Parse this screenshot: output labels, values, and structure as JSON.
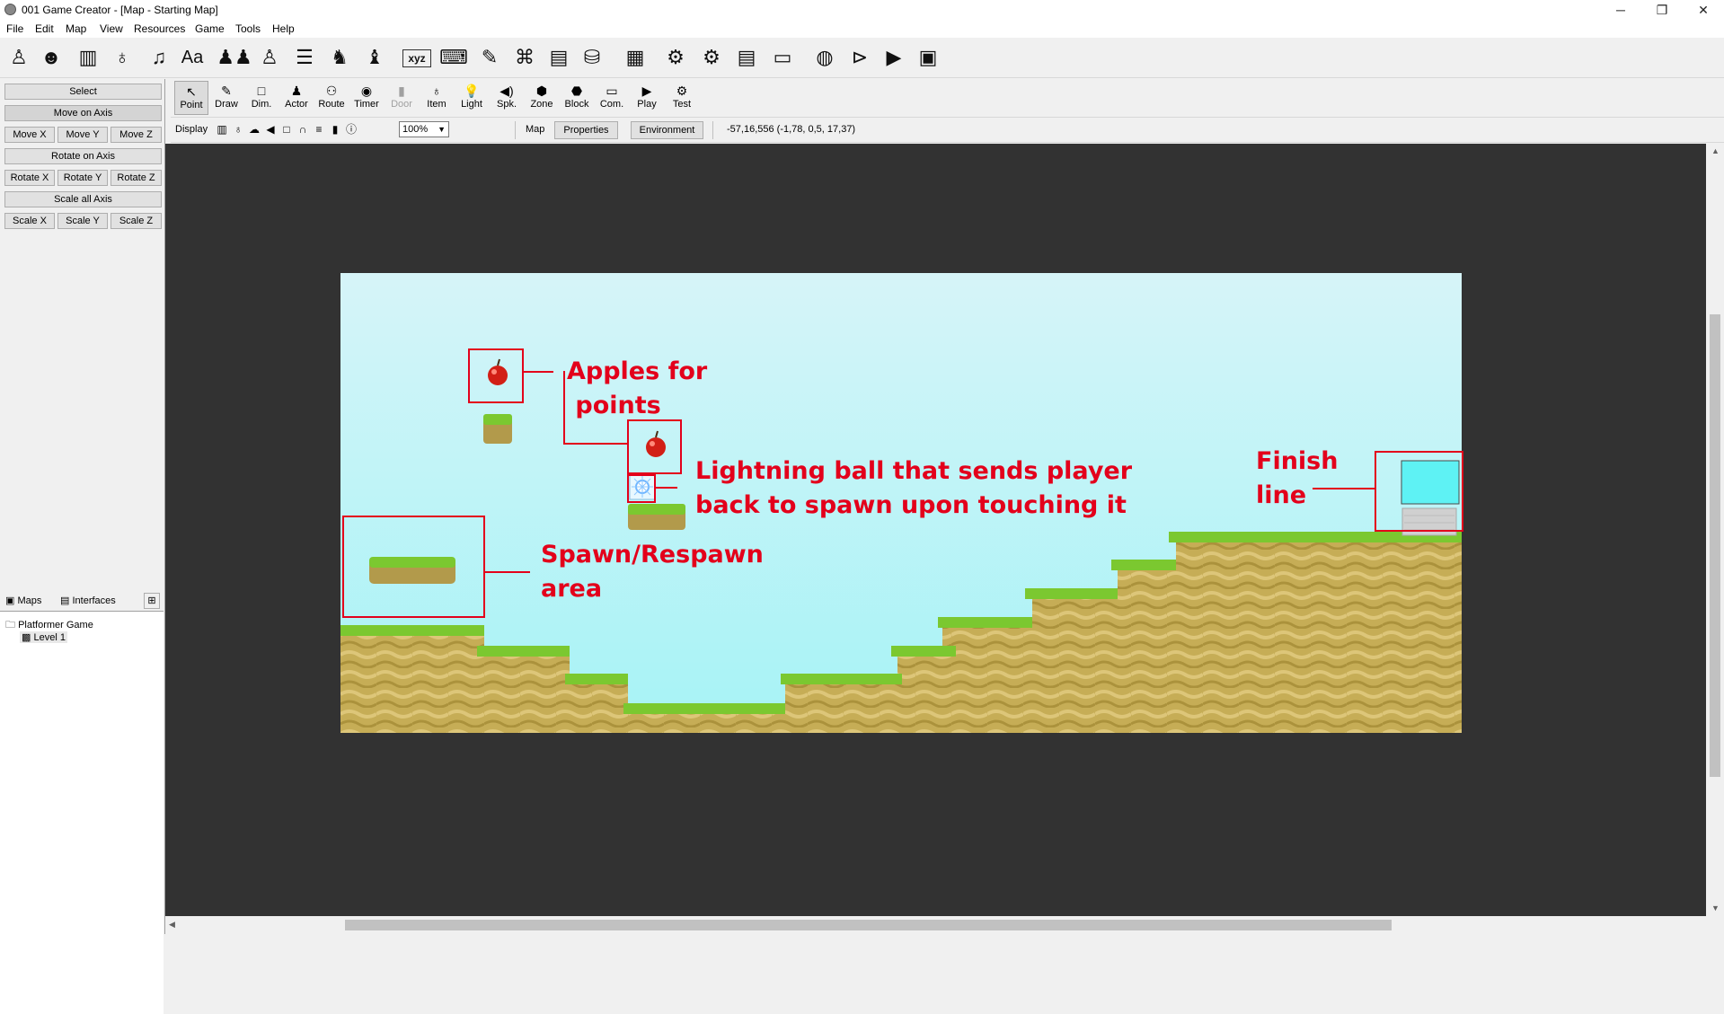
{
  "window": {
    "title": "001 Game Creator - [Map - Starting Map]",
    "controls": [
      "minimize-icon",
      "restore-icon",
      "close-icon"
    ]
  },
  "menu": [
    "File",
    "Edit",
    "Map",
    "View",
    "Resources",
    "Game",
    "Tools",
    "Help"
  ],
  "resource_toolbar": {
    "text_icons": {
      "fonts": "Aa",
      "variables": "xyz"
    }
  },
  "transform_panel": {
    "select": "Select",
    "move_on_axis": "Move on Axis",
    "move_x": "Move X",
    "move_y": "Move Y",
    "move_z": "Move Z",
    "rotate_on_axis": "Rotate on Axis",
    "rotate_x": "Rotate X",
    "rotate_y": "Rotate Y",
    "rotate_z": "Rotate Z",
    "scale_all_axis": "Scale all Axis",
    "scale_x": "Scale X",
    "scale_y": "Scale Y",
    "scale_z": "Scale Z"
  },
  "tree": {
    "tabs": [
      "Maps",
      "Interfaces"
    ],
    "root": "Platformer Game",
    "child": "Level 1"
  },
  "map_tools": [
    {
      "label": "Point",
      "glyph": "↖",
      "active": true
    },
    {
      "label": "Draw",
      "glyph": "✎"
    },
    {
      "label": "Dim.",
      "glyph": "□"
    },
    {
      "label": "Actor",
      "glyph": "♟"
    },
    {
      "label": "Route",
      "glyph": "⚇"
    },
    {
      "label": "Timer",
      "glyph": "◉"
    },
    {
      "label": "Door",
      "glyph": "▮",
      "disabled": true
    },
    {
      "label": "Item",
      "glyph": "♁"
    },
    {
      "label": "Light",
      "glyph": "💡"
    },
    {
      "label": "Spk.",
      "glyph": "◀)"
    },
    {
      "label": "Zone",
      "glyph": "⬢"
    },
    {
      "label": "Block",
      "glyph": "⬣"
    },
    {
      "label": "Com.",
      "glyph": "▭"
    },
    {
      "label": "Play",
      "glyph": "▶"
    },
    {
      "label": "Test",
      "glyph": "⚙"
    }
  ],
  "display_bar": {
    "display_label": "Display",
    "zoom": "100%",
    "map_label": "Map",
    "properties": "Properties",
    "environment": "Environment",
    "coordinates": "-57,16,556 (-1,78, 0,5, 17,37)"
  },
  "map_annotations": {
    "apples": "Apples for\n points",
    "lightning": "Lightning ball that sends player\nback to spawn upon touching it",
    "spawn": "Spawn/Respawn\narea",
    "finish": "Finish\nline"
  },
  "colors": {
    "annotation_red": "#e3001b",
    "sky_top": "#d6f4f8",
    "sky_bottom": "#a6f3f6",
    "grass": "#7bc830",
    "dirt": "#c6ad56",
    "finish_block": "#5ef2f4",
    "viewport_bg": "#323232"
  }
}
